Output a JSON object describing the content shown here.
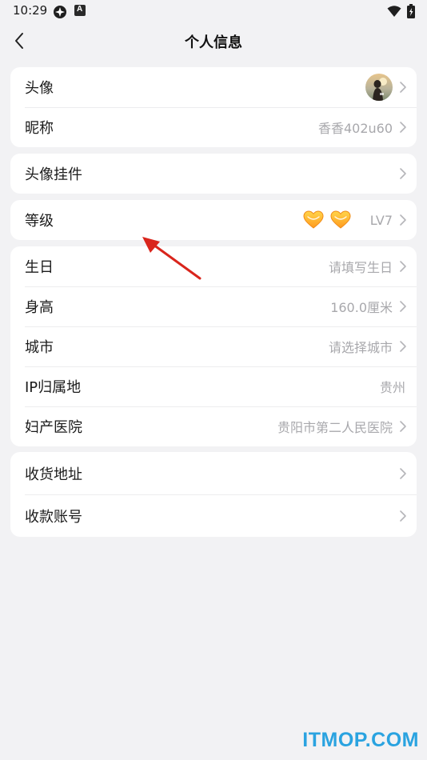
{
  "status_bar": {
    "time": "10:29",
    "icons": [
      "sync-icon",
      "a-badge-icon",
      "wifi-icon",
      "battery-icon"
    ],
    "badge_letter": "A"
  },
  "header": {
    "title": "个人信息",
    "back_icon": "chevron-left-icon"
  },
  "sections": {
    "profile": {
      "avatar_label": "头像",
      "nickname_label": "昵称",
      "nickname_value": "香香402u60"
    },
    "pendant": {
      "label": "头像挂件"
    },
    "level": {
      "label": "等级",
      "value": "LV7",
      "badge_icons": [
        "heart-icon",
        "heart-icon"
      ]
    },
    "details": {
      "birthday_label": "生日",
      "birthday_value": "请填写生日",
      "height_label": "身高",
      "height_value": "160.0厘米",
      "city_label": "城市",
      "city_value": "请选择城市",
      "ip_label": "IP归属地",
      "ip_value": "贵州",
      "hospital_label": "妇产医院",
      "hospital_value": "贵阳市第二人民医院"
    },
    "account": {
      "address_label": "收货地址",
      "payment_label": "收款账号"
    }
  },
  "watermark": "ITMOP.COM",
  "colors": {
    "background": "#f2f2f4",
    "card": "#ffffff",
    "value_text": "#a8a8ac",
    "annotation": "#d9251c",
    "watermark": "#2aa3e0"
  }
}
